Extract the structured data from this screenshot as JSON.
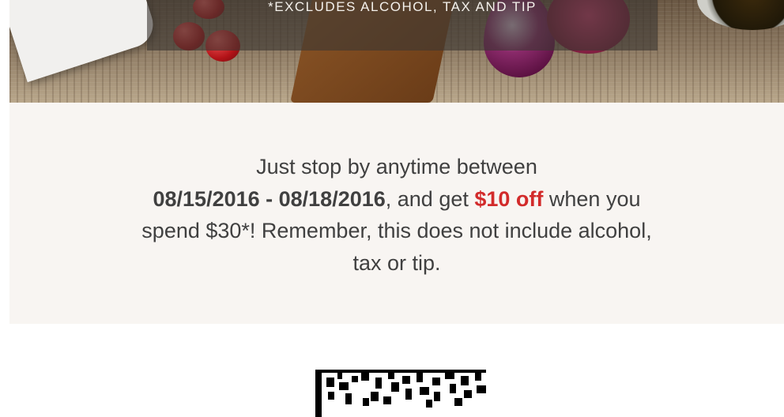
{
  "hero": {
    "banner_text": "*EXCLUDES ALCOHOL, TAX AND TIP"
  },
  "offer": {
    "line1": "Just stop by anytime between",
    "dates": "08/15/2016 - 08/18/2016",
    "mid": ", and get ",
    "discount": "$10 off",
    "after_discount": " when you spend $30*! Remember, this does not include alcohol, tax or tip.",
    "accent_color": "#d22b2b"
  },
  "barcode": {
    "icon": "2d-barcode-icon"
  }
}
